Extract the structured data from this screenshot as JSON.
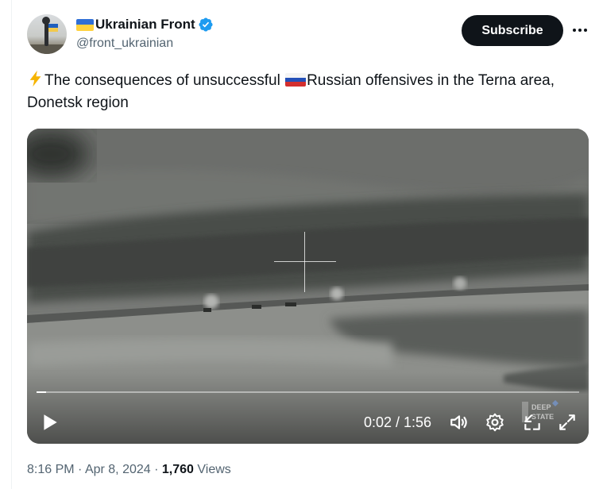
{
  "author": {
    "display_name": "Ukrainian Front",
    "handle": "@front_ukrainian",
    "flag_icon": "ukraine-flag-icon",
    "verified_icon": "verified-badge-icon"
  },
  "actions": {
    "subscribe_label": "Subscribe",
    "more_icon": "more-dots-icon"
  },
  "tweet": {
    "text_part1": "The consequences of unsuccessful ",
    "text_part2": "Russian offensives in the Terna area, Donetsk region",
    "lead_icon": "lightning-bolt-icon",
    "inline_flag_icon": "russia-flag-icon"
  },
  "video": {
    "time_display": "0:02 / 1:56",
    "current": "0:02",
    "duration": "1:56",
    "progress_fraction": 0.017,
    "watermark": [
      "DEEP",
      "STATE"
    ],
    "controls": [
      "play-icon",
      "volume-icon",
      "settings-gear-icon",
      "minimize-icon",
      "fullscreen-icon"
    ]
  },
  "meta": {
    "time": "8:16 PM",
    "separator": "·",
    "date": "Apr 8, 2024",
    "views_count": "1,760",
    "views_label": "Views"
  },
  "colors": {
    "text_primary": "#0f1419",
    "text_secondary": "#536471",
    "verified_blue": "#1d9bf0",
    "button_dark": "#0f1419"
  }
}
